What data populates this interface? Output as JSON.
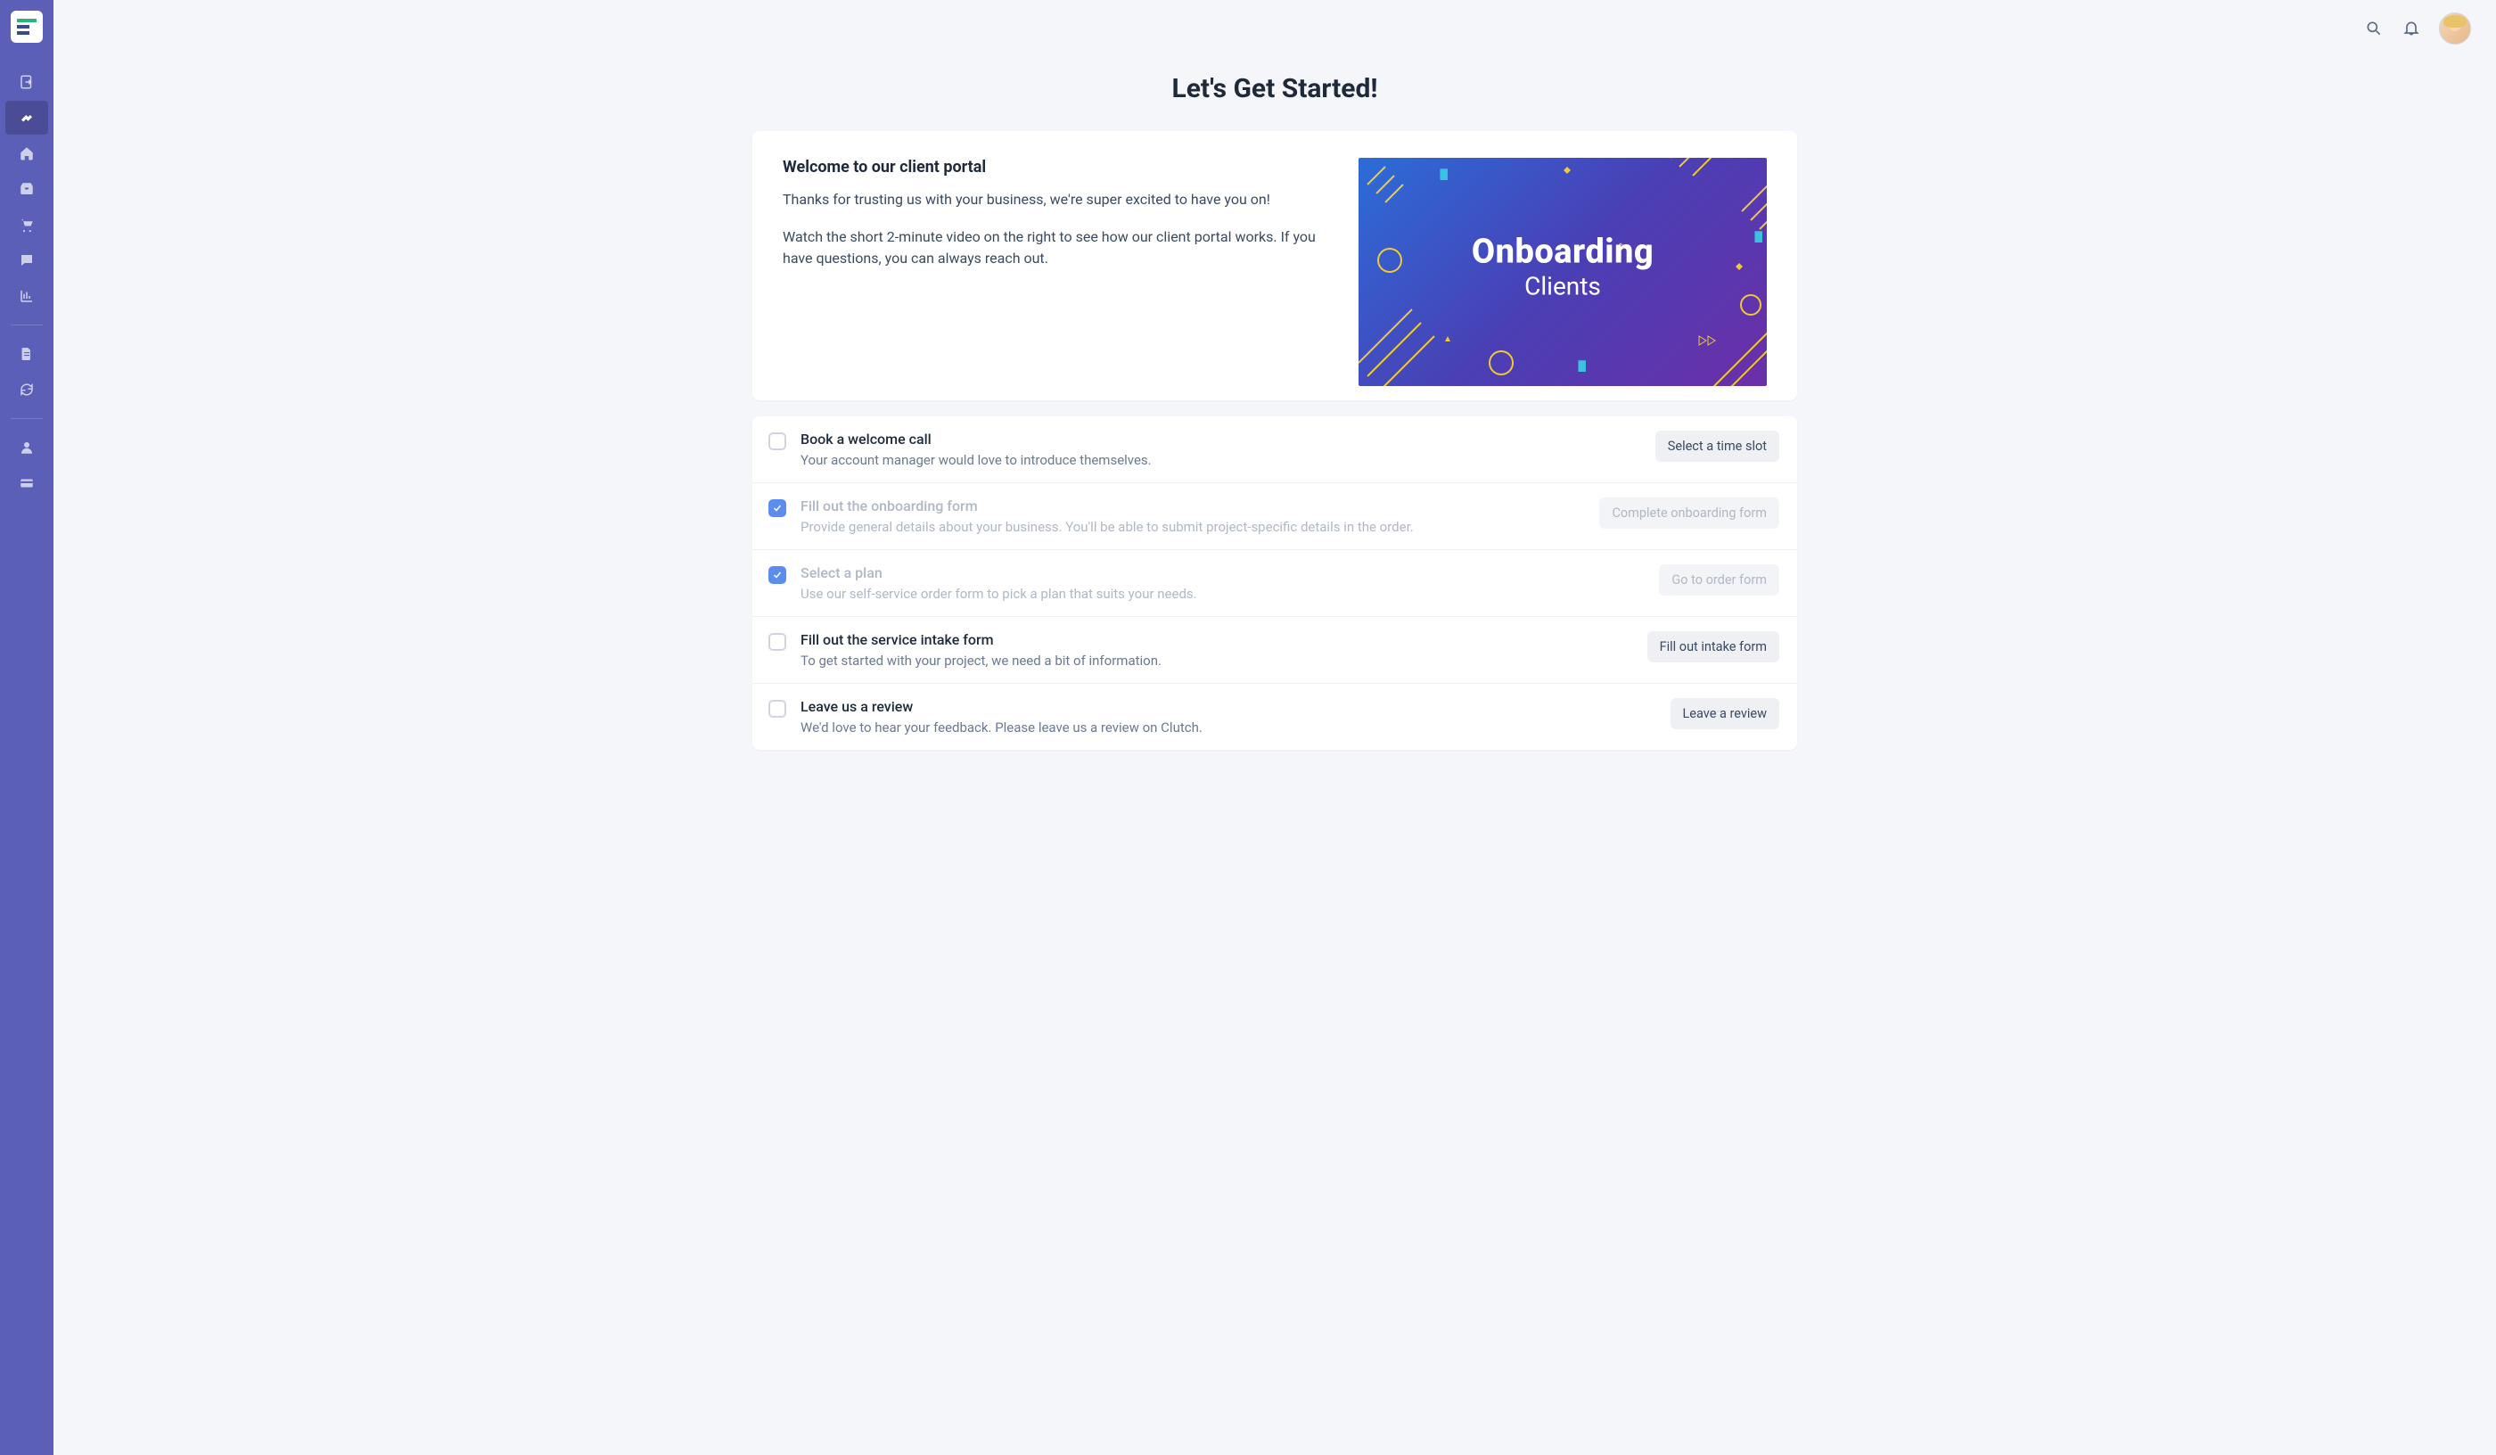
{
  "page": {
    "title": "Let's Get Started!"
  },
  "welcome": {
    "heading": "Welcome to our client portal",
    "p1": "Thanks for trusting us with your business, we're super excited to have you on!",
    "p2": "Watch the short 2-minute video on the right to see how our client portal works. If you have questions, you can always reach out."
  },
  "video": {
    "line1": "Onboarding",
    "line2": "Clients"
  },
  "tasks": [
    {
      "title": "Book a welcome call",
      "desc": "Your account manager would love to introduce themselves.",
      "action": "Select a time slot",
      "done": false
    },
    {
      "title": "Fill out the onboarding form",
      "desc": "Provide general details about your business. You'll be able to submit project-specific details in the order.",
      "action": "Complete onboarding form",
      "done": true
    },
    {
      "title": "Select a plan",
      "desc": "Use our self-service order form to pick a plan that suits your needs.",
      "action": "Go to order form",
      "done": true
    },
    {
      "title": "Fill out the service intake form",
      "desc": "To get started with your project, we need a bit of information.",
      "action": "Fill out intake form",
      "done": false
    },
    {
      "title": "Leave us a review",
      "desc": "We'd love to hear your feedback. Please leave us a review on Clutch.",
      "action": "Leave a review",
      "done": false
    }
  ],
  "sidebar": {
    "items": [
      {
        "name": "login-icon"
      },
      {
        "name": "handshake-icon",
        "active": true
      },
      {
        "name": "home-icon"
      },
      {
        "name": "inbox-icon"
      },
      {
        "name": "cart-icon"
      },
      {
        "name": "chat-icon"
      },
      {
        "name": "chart-icon"
      }
    ],
    "lower": [
      {
        "name": "file-icon"
      },
      {
        "name": "sync-icon"
      }
    ],
    "bottom": [
      {
        "name": "user-icon"
      },
      {
        "name": "card-icon"
      }
    ]
  }
}
